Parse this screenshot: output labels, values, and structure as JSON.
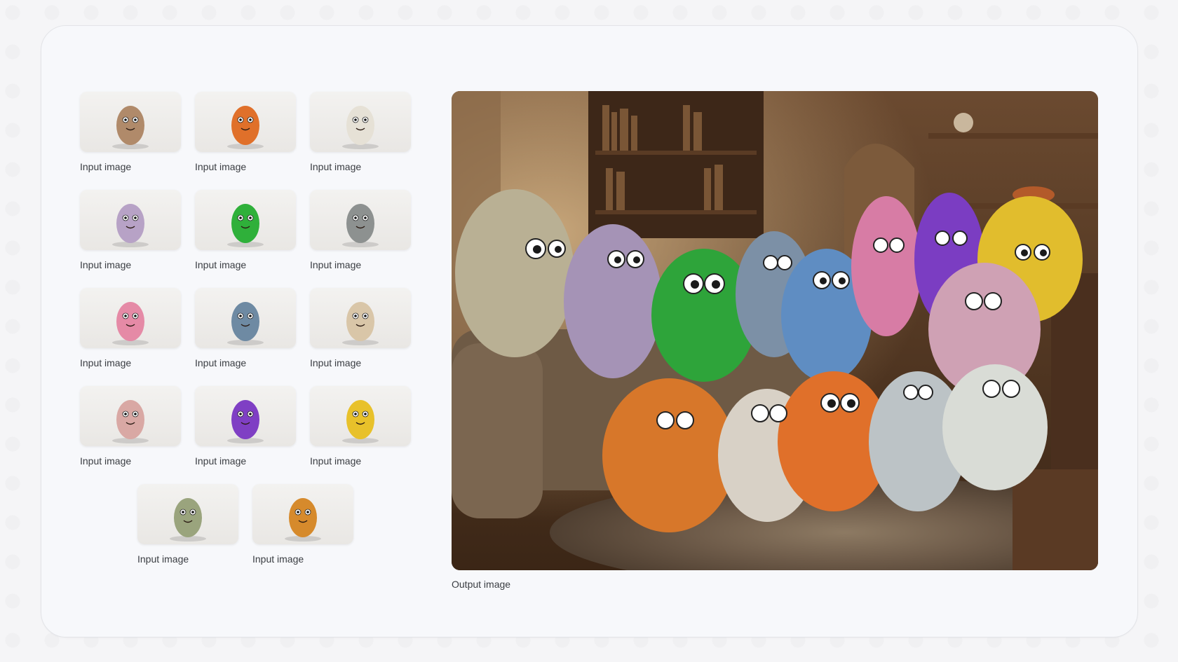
{
  "inputs": [
    {
      "caption": "Input image",
      "subject": "brown-white monster with wizard hat and scarf",
      "color": "#b08a6a"
    },
    {
      "caption": "Input image",
      "subject": "orange fluffy monster",
      "color": "#e0702a"
    },
    {
      "caption": "Input image",
      "subject": "white sheep with party hat",
      "color": "#e6e1d6"
    },
    {
      "caption": "Input image",
      "subject": "lavender spotted tall monster",
      "color": "#b7a2c6"
    },
    {
      "caption": "Input image",
      "subject": "green fuzzy monster",
      "color": "#2fb03a"
    },
    {
      "caption": "Input image",
      "subject": "gray shaggy monster",
      "color": "#8d9190"
    },
    {
      "caption": "Input image",
      "subject": "pink thin monster",
      "color": "#e58aa6"
    },
    {
      "caption": "Input image",
      "subject": "blue-gray round monster",
      "color": "#6e8aa3"
    },
    {
      "caption": "Input image",
      "subject": "cream fluffy puff monster",
      "color": "#d9c6a8"
    },
    {
      "caption": "Input image",
      "subject": "pastel rainbow monster",
      "color": "#d9a8a4"
    },
    {
      "caption": "Input image",
      "subject": "purple tall monster",
      "color": "#7f3fc4"
    },
    {
      "caption": "Input image",
      "subject": "yellow fluffy monster",
      "color": "#e8c12a"
    },
    {
      "caption": "Input image",
      "subject": "green-beige shaggy monster",
      "color": "#9aa47d"
    },
    {
      "caption": "Input image",
      "subject": "orange cone-head monster",
      "color": "#d68a2c"
    }
  ],
  "output": {
    "caption": "Output image",
    "scene": "all monsters gathered on a couch in a cozy room"
  }
}
